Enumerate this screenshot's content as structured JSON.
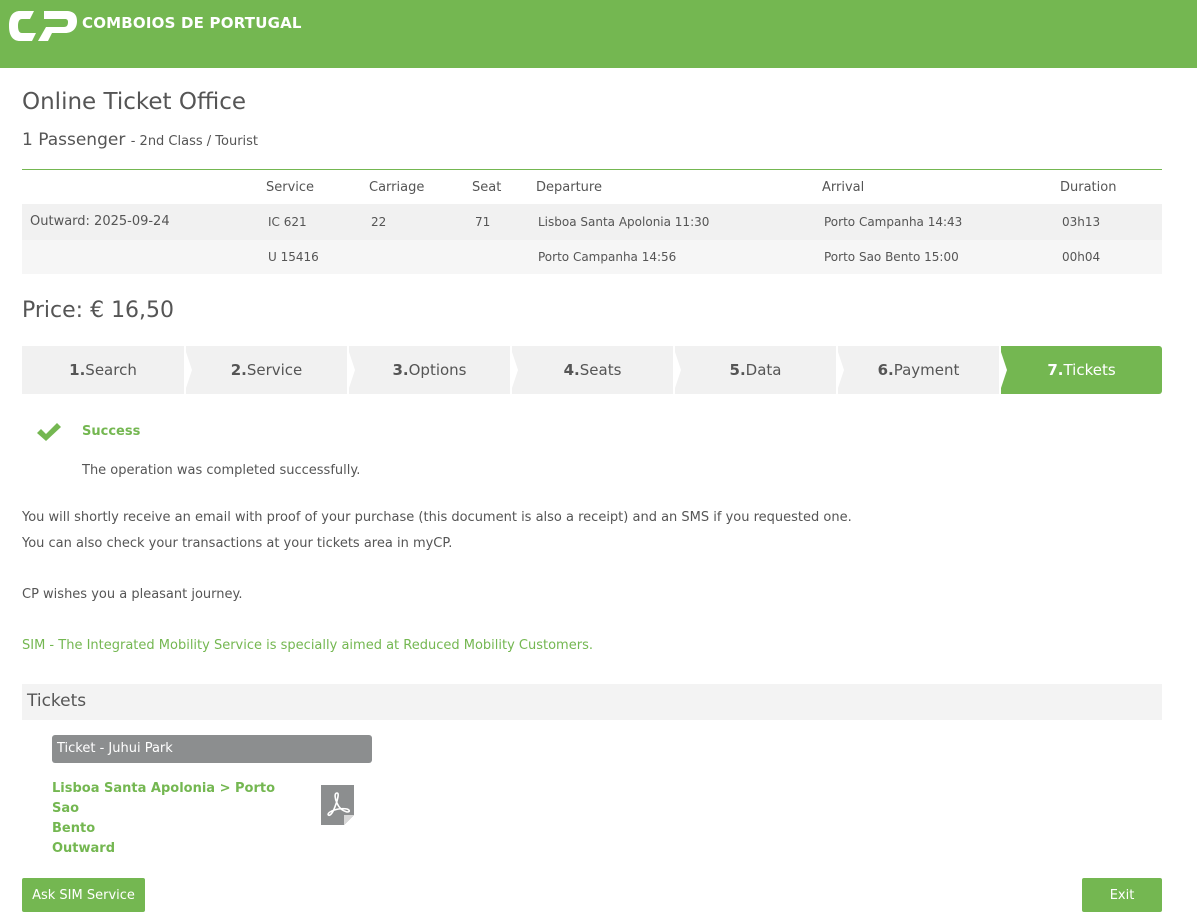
{
  "header": {
    "brand": "COMBOIOS DE PORTUGAL",
    "brand_color": "#74b751"
  },
  "page": {
    "title": "Online Ticket Office",
    "passengers": "1 Passenger",
    "class": "- 2nd Class / Tourist"
  },
  "journey": {
    "headers": {
      "service": "Service",
      "carriage": "Carriage",
      "seat": "Seat",
      "departure": "Departure",
      "arrival": "Arrival",
      "duration": "Duration"
    },
    "rows": [
      {
        "label": "Outward: 2025-09-24",
        "service": "IC 621",
        "carriage": "22",
        "seat": "71",
        "departure": "Lisboa Santa Apolonia 11:30",
        "arrival": "Porto Campanha 14:43",
        "duration": "03h13"
      },
      {
        "label": "",
        "service": "U 15416",
        "carriage": "",
        "seat": "",
        "departure": "Porto Campanha 14:56",
        "arrival": "Porto Sao Bento 15:00",
        "duration": "00h04"
      }
    ]
  },
  "price": "Price: € 16,50",
  "steps": [
    {
      "num": "1.",
      "label": "Search"
    },
    {
      "num": "2.",
      "label": "Service"
    },
    {
      "num": "3.",
      "label": "Options"
    },
    {
      "num": "4.",
      "label": "Seats"
    },
    {
      "num": "5.",
      "label": "Data"
    },
    {
      "num": "6.",
      "label": "Payment"
    },
    {
      "num": "7.",
      "label": "Tickets"
    }
  ],
  "result": {
    "title": "Success",
    "message": "The operation was completed successfully.",
    "icon": "checkmark-icon"
  },
  "info": {
    "line1": "You will shortly receive an email with proof of your purchase (this document is also a receipt) and an SMS if you requested one.",
    "line2": "You can also check your transactions at your tickets area in myCP.",
    "line3": "CP wishes you a pleasant journey.",
    "sim": "SIM - The Integrated Mobility Service is specially aimed at Reduced Mobility Customers."
  },
  "tickets": {
    "title": "Tickets",
    "tag": "Ticket - Juhui Park",
    "route_line1": "Lisboa Santa Apolonia > Porto Sao",
    "route_line2": "Bento",
    "direction": "Outward",
    "file_icon": "pdf-icon"
  },
  "buttons": {
    "sim": "Ask SIM Service",
    "exit": "Exit"
  }
}
